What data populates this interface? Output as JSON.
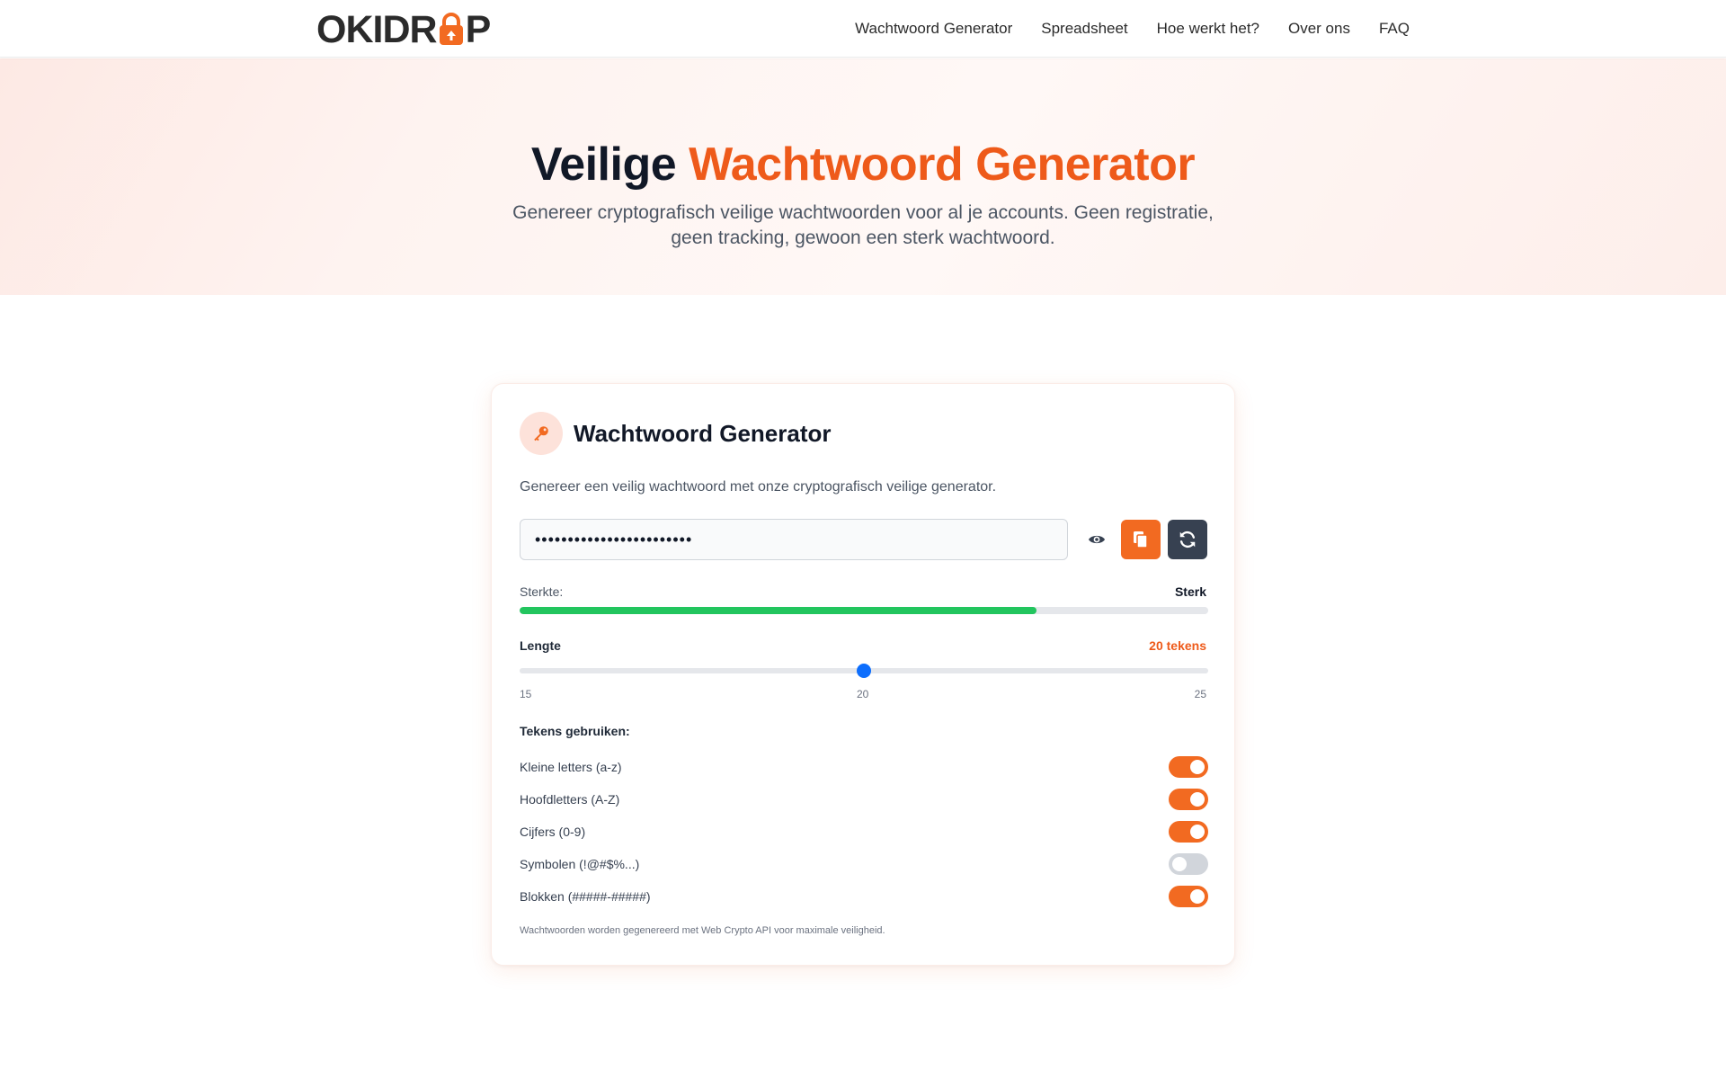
{
  "header": {
    "logo_text_left": "OKIDR",
    "logo_text_right": "P",
    "nav": [
      {
        "label": "Wachtwoord Generator"
      },
      {
        "label": "Spreadsheet"
      },
      {
        "label": "Hoe werkt het?"
      },
      {
        "label": "Over ons"
      },
      {
        "label": "FAQ"
      }
    ]
  },
  "hero": {
    "title_plain": "Veilige",
    "title_accent": "Wachtwoord Generator",
    "subtitle": "Genereer cryptografisch veilige wachtwoorden voor al je accounts. Geen registratie, geen tracking, gewoon een sterk wachtwoord."
  },
  "card": {
    "icon": "key-icon",
    "title": "Wachtwoord Generator",
    "description": "Genereer een veilig wachtwoord met onze cryptografisch veilige generator.",
    "password_masked": "••••••••••••••••••••••••",
    "buttons": {
      "show": "eye-icon",
      "copy": "copy-icon",
      "regenerate": "refresh-icon"
    },
    "strength": {
      "label": "Sterkte:",
      "value": "Sterk",
      "level": 0.75,
      "color": "#22c55e"
    },
    "length": {
      "label": "Lengte",
      "value_text": "20 tekens",
      "min": 15,
      "max": 25,
      "value": 20,
      "tick_min": "15",
      "tick_mid": "20",
      "tick_max": "25"
    },
    "chars_heading": "Tekens gebruiken:",
    "options": [
      {
        "label": "Kleine letters (a-z)",
        "on": true
      },
      {
        "label": "Hoofdletters (A-Z)",
        "on": true
      },
      {
        "label": "Cijfers (0-9)",
        "on": true
      },
      {
        "label": "Symbolen (!@#$%...)",
        "on": false
      },
      {
        "label": "Blokken (#####-#####)",
        "on": true
      }
    ],
    "footnote": "Wachtwoorden worden gegenereerd met Web Crypto API voor maximale veiligheid."
  },
  "colors": {
    "accent": "#ee5a1a",
    "button_orange": "#f26a21",
    "button_dark": "#374151",
    "slider": "#0d6efd"
  }
}
